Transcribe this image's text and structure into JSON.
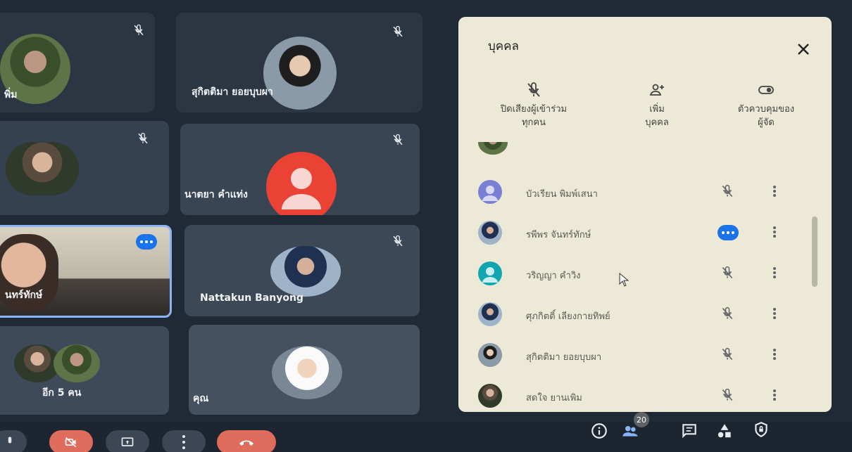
{
  "tiles": [
    {
      "name": "พิ่ม"
    },
    {
      "name": "สุกิตติมา ยอยบุบผา"
    },
    {
      "name": ""
    },
    {
      "name": "นาตยา คำแท่ง"
    },
    {
      "name": "นทร์ทักษ์"
    },
    {
      "name": "Nattakun Banyong"
    },
    {
      "name": "อีก 5 คน"
    },
    {
      "name": "คุณ"
    }
  ],
  "panel": {
    "title": "บุคคล",
    "actions": [
      {
        "label_line1": "ปิดเสียงผู้เข้าร่วม",
        "label_line2": "ทุกคน",
        "icon": "mic-off-icon"
      },
      {
        "label_line1": "เพิ่ม",
        "label_line2": "บุคคล",
        "icon": "person-add-icon"
      },
      {
        "label_line1": "ตัวควบคุมของ",
        "label_line2": "ผู้จัด",
        "icon": "toggle-icon"
      }
    ],
    "participants": [
      {
        "name": "บัวเรียน พิมพ์เสนา",
        "status": "muted"
      },
      {
        "name": "รพีพร จันทร์ทักษ์",
        "status": "speaking"
      },
      {
        "name": "วริญญา คำวิง",
        "status": "muted"
      },
      {
        "name": "ศุภกิตติ์ เลียงกายทิพย์",
        "status": "muted"
      },
      {
        "name": "สุกิตติมา ยอยบุบผา",
        "status": "muted"
      },
      {
        "name": "สดใจ ยานเพิม",
        "status": "muted"
      }
    ]
  },
  "bottom": {
    "participant_count": "20"
  },
  "colors": {
    "accent": "#8ab4f8",
    "danger": "#ea4335",
    "speaking": "#1a73e8",
    "panel_bg": "#ece9d6"
  }
}
